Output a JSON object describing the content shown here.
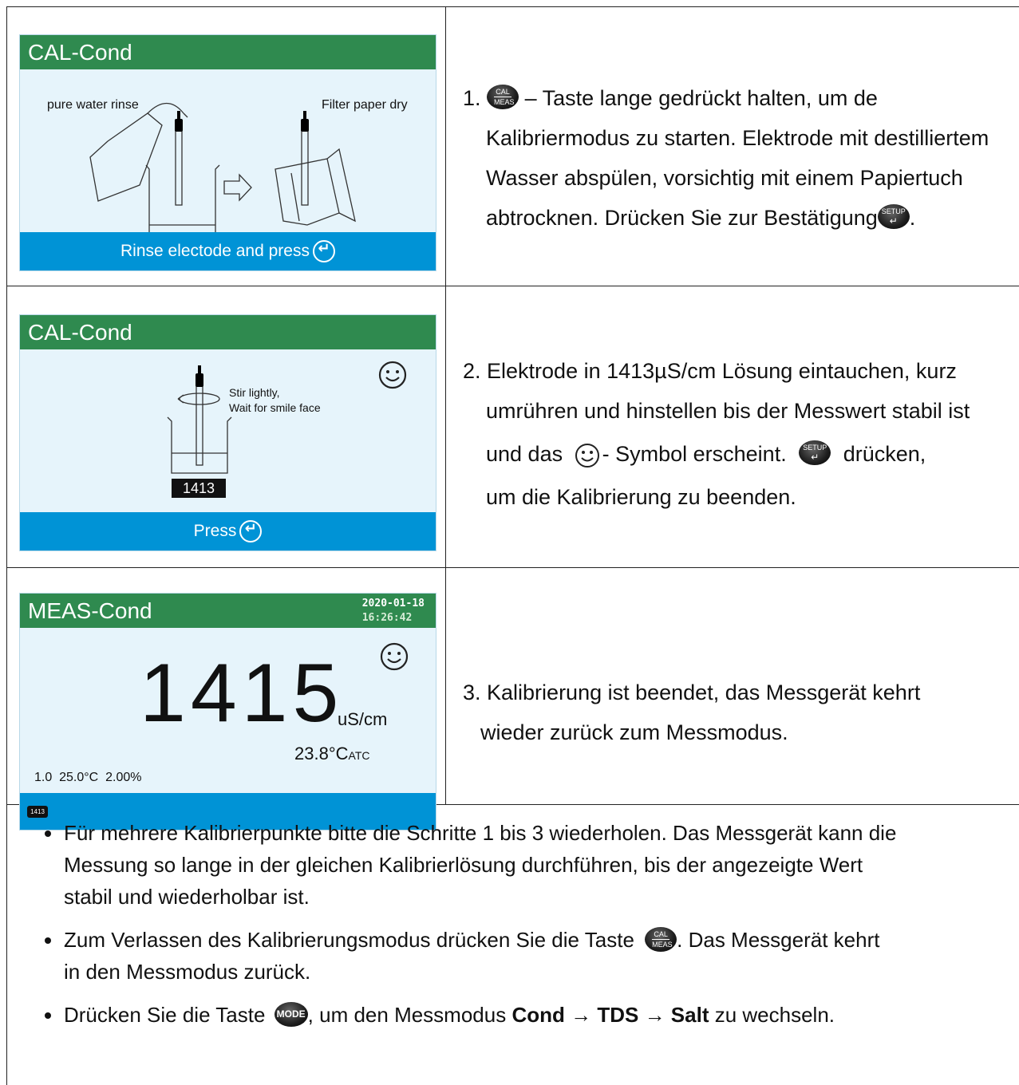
{
  "panel1": {
    "title": "CAL-Cond",
    "left_label": "pure water rinse",
    "right_label": "Filter paper dry",
    "footer": "Rinse electode and press"
  },
  "panel2": {
    "title": "CAL-Cond",
    "instruction_line1": "Stir lightly,",
    "instruction_line2": "Wait for smile face",
    "value": "1413",
    "footer": "Press"
  },
  "panel3": {
    "title": "MEAS-Cond",
    "date": "2020-01-18",
    "time": "16:26:42",
    "reading": "1415",
    "unit": "uS/cm",
    "temperature": "23.8°C",
    "temp_mode": "ATC",
    "status_line": "1.0  25.0°C  2.00%",
    "buffer_badge": "1413"
  },
  "step1": {
    "number": "1.",
    "key_cal_top": "CAL",
    "key_cal_bottom": "MEAS",
    "line1": "– Taste lange gedrückt halten, um de",
    "line2": "Kalibriermodus zu starten. Elektrode mit destilliertem",
    "line3": "Wasser abspülen, vorsichtig mit einem Papiertuch",
    "line4": "abtrocknen. Drücken Sie zur Bestätigung",
    "line4_end": ".",
    "key_setup_top": "SETUP",
    "key_setup_bottom": "↵"
  },
  "step2": {
    "line1": "2. Elektrode in 1413µS/cm Lösung eintauchen, kurz",
    "line2": "umrühren und hinstellen bis der Messwert stabil ist",
    "line3_a": "und das",
    "line3_b": "- Symbol erscheint.",
    "line3_c": "drücken,",
    "line4": "um die Kalibrierung zu beenden."
  },
  "step3": {
    "line1": "3. Kalibrierung ist beendet, das Messgerät kehrt",
    "line2": "wieder zurück zum Messmodus."
  },
  "notes": {
    "b1_l1": "Für mehrere Kalibrierpunkte bitte die Schritte 1 bis 3 wiederholen. Das Messgerät kann die",
    "b1_l2": "Messung so lange in der gleichen Kalibrierlösung durchführen, bis der angezeigte Wert",
    "b1_l3": "stabil und wiederholbar ist.",
    "b2_a": "Zum Verlassen des Kalibrierungsmodus drücken Sie die Taste",
    "b2_b": ". Das Messgerät kehrt",
    "b2_l2": "in den Messmodus zurück.",
    "b3_a": "Drücken Sie die Taste",
    "b3_key": "MODE",
    "b3_b": ", um den Messmodus",
    "b3_cond": "Cond",
    "b3_arrow1": " → ",
    "b3_tds": "TDS",
    "b3_arrow2": " → ",
    "b3_salt": "Salt",
    "b3_c": " zu wechseln."
  },
  "colors": {
    "title_bar": "#2f8a4f",
    "footer_bar": "#0093d6",
    "screen_bg": "#e6f4fb"
  }
}
